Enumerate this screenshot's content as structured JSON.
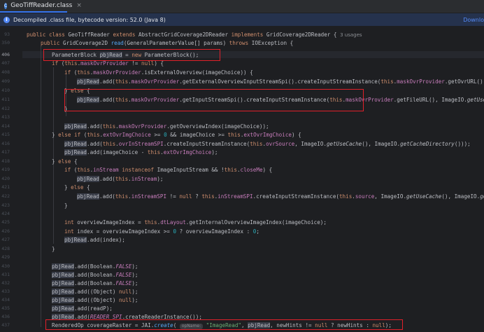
{
  "tab": {
    "title": "GeoTiffReader.class",
    "close": "×"
  },
  "banner": {
    "icon": "info-icon",
    "text": "Decompiled .class file, bytecode version: 52.0 (Java 8)",
    "link": "Downlo"
  },
  "colors": {
    "highlight_box": "#e0202a",
    "accent": "#3574f0"
  },
  "line_numbers": [
    "93",
    "350",
    "",
    "406",
    "407",
    "408",
    "409",
    "410",
    "411",
    "412",
    "413",
    "414",
    "415",
    "416",
    "417",
    "418",
    "419",
    "420",
    "421",
    "422",
    "423",
    "424",
    "425",
    "426",
    "427",
    "428",
    "429",
    "430",
    "431",
    "432",
    "433",
    "434",
    "435",
    "436",
    "437"
  ],
  "code": {
    "l1": {
      "kw1": "public class ",
      "name": "GeoTiffReader ",
      "kw2": "extends ",
      "sup": "AbstractGridCoverage2DReader ",
      "kw3": "implements ",
      "intf": "GridCoverage2DReader {",
      "usages": "3 usages"
    },
    "l2": {
      "kw1": "public ",
      "t1": "GridCoverage2D ",
      "m": "read",
      "t2": "(GeneralParameterValue[] params) ",
      "kw2": "throws ",
      "t3": "IOException {"
    },
    "l3": {
      "t1": "ParameterBlock ",
      "v": "pbjRead",
      "t2": " = ",
      "kw": "new ",
      "t3": "ParameterBlock();"
    },
    "l4": {
      "kw1": "if ",
      "t1": "(",
      "kw2": "this",
      "t2": ".",
      "f": "maskOvrProvider",
      "t3": " != ",
      "kw3": "null",
      "t4": ") {"
    },
    "l5": {
      "kw1": "if ",
      "t1": "(",
      "kw2": "this",
      "t2": ".",
      "f": "maskOvrProvider",
      "t3": ".isExternalOverview(imageChoice)) {"
    },
    "l6": {
      "v": "pbjRead",
      "t1": ".add(",
      "kw1": "this",
      "t2": ".",
      "f1": "maskOvrProvider",
      "t3": ".getExternalOverviewInputStreamSpi().createInputStreamInstance(",
      "kw2": "this",
      "t4": ".",
      "f2": "maskOvrProvider",
      "t5": ".getOvrURL(),"
    },
    "l7": {
      "t1": "} ",
      "kw": "else ",
      "t2": "{"
    },
    "l8": {
      "v": "pbjRead",
      "t1": ".add(",
      "kw1": "this",
      "t2": ".",
      "f1": "maskOvrProvider",
      "t3": ".getInputStreamSpi().createInputStreamInstance(",
      "kw2": "this",
      "t4": ".",
      "f2": "maskOvrProvider",
      "t5": ".getFileURL(), ImageIO.",
      "s": "getUseC"
    },
    "l9": {
      "t": "}"
    },
    "l10": {
      "v": "pbjRead",
      "t1": ".add(",
      "kw": "this",
      "t2": ".",
      "f": "maskOvrProvider",
      "t3": ".getOverviewIndex(imageChoice));"
    },
    "l11": {
      "t1": "} ",
      "kw1": "else if ",
      "t2": "(",
      "kw2": "this",
      "t3": ".",
      "f1": "extOvrImgChoice",
      "t4": " >= ",
      "n": "0",
      "t5": " && imageChoice >= ",
      "kw3": "this",
      "t6": ".",
      "f2": "extOvrImgChoice",
      "t7": ") {"
    },
    "l12": {
      "v": "pbjRead",
      "t1": ".add(",
      "kw1": "this",
      "t2": ".",
      "f1": "ovrInStreamSPI",
      "t3": ".createInputStreamInstance(",
      "kw2": "this",
      "t4": ".",
      "f2": "ovrSource",
      "t5": ", ImageIO.",
      "s1": "getUseCache",
      "t6": "(), ImageIO.",
      "s2": "getCacheDirectory",
      "t7": "()));"
    },
    "l13": {
      "v": "pbjRead",
      "t1": ".add(imageChoice - ",
      "kw": "this",
      "t2": ".",
      "f": "extOvrImgChoice",
      "t3": ");"
    },
    "l14": {
      "t1": "} ",
      "kw": "else ",
      "t2": "{"
    },
    "l15": {
      "kw1": "if ",
      "t1": "(",
      "kw2": "this",
      "t2": ".",
      "f1": "inStream",
      "t3": " ",
      "kw3": "instanceof ",
      "t4": "ImageInputStream && !",
      "kw4": "this",
      "t5": ".",
      "f2": "closeMe",
      "t6": ") {"
    },
    "l16": {
      "v": "pbjRead",
      "t1": ".add(",
      "kw": "this",
      "t2": ".",
      "f": "inStream",
      "t3": ");"
    },
    "l17": {
      "t1": "} ",
      "kw": "else ",
      "t2": "{"
    },
    "l18": {
      "v": "pbjRead",
      "t1": ".add(",
      "kw1": "this",
      "t2": ".",
      "f1": "inStreamSPI",
      "t3": " != ",
      "kw2": "null",
      "t4": " ? ",
      "kw3": "this",
      "t5": ".",
      "f2": "inStreamSPI",
      "t6": ".createInputStreamInstance(",
      "kw4": "this",
      "t7": ".",
      "f3": "source",
      "t8": ", ImageIO.",
      "s": "getUseCache",
      "t9": "(), ImageIO.",
      "s2": "get"
    },
    "l19": {
      "t": "}"
    },
    "l20": {
      "kw1": "int ",
      "t1": "overviewImageIndex = ",
      "kw2": "this",
      "t2": ".",
      "f": "dtLayout",
      "t3": ".getInternalOverviewImageIndex(imageChoice);"
    },
    "l21": {
      "kw1": "int ",
      "t1": "index = overviewImageIndex >= ",
      "n1": "0",
      "t2": " ? overviewImageIndex : ",
      "n2": "0",
      "t3": ";"
    },
    "l22": {
      "v": "pbjRead",
      "t": ".add(index);"
    },
    "l23": {
      "t": "}"
    },
    "l24": {
      "v": "pbjRead",
      "t1": ".add(Boolean.",
      "c": "FALSE",
      "t2": ");"
    },
    "l25": {
      "v": "pbjRead",
      "t1": ".add(Boolean.",
      "c": "FALSE",
      "t2": ");"
    },
    "l26": {
      "v": "pbjRead",
      "t1": ".add(Boolean.",
      "c": "FALSE",
      "t2": ");"
    },
    "l27": {
      "v": "pbjRead",
      "t1": ".add((Object) ",
      "kw": "null",
      "t2": ");"
    },
    "l28": {
      "v": "pbjRead",
      "t1": ".add((Object) ",
      "kw": "null",
      "t2": ");"
    },
    "l29": {
      "v": "pbjRead",
      "t": ".add(readP);"
    },
    "l30": {
      "v": "pbjRead",
      "t1": ".add(",
      "c": "READER_SPI",
      "t2": ".createReaderInstance());"
    },
    "l31": {
      "t1": "RenderedOp coverageRaster = JAI.",
      "m": "create",
      "t2": "( ",
      "hint": "opName:",
      "str": " \"ImageRead\"",
      "t3": ", ",
      "v": "pbjRead",
      "t4": ", newHints != ",
      "kw": "null",
      "t5": " ? newHints : ",
      "kw2": "null",
      "t6": ");"
    }
  }
}
